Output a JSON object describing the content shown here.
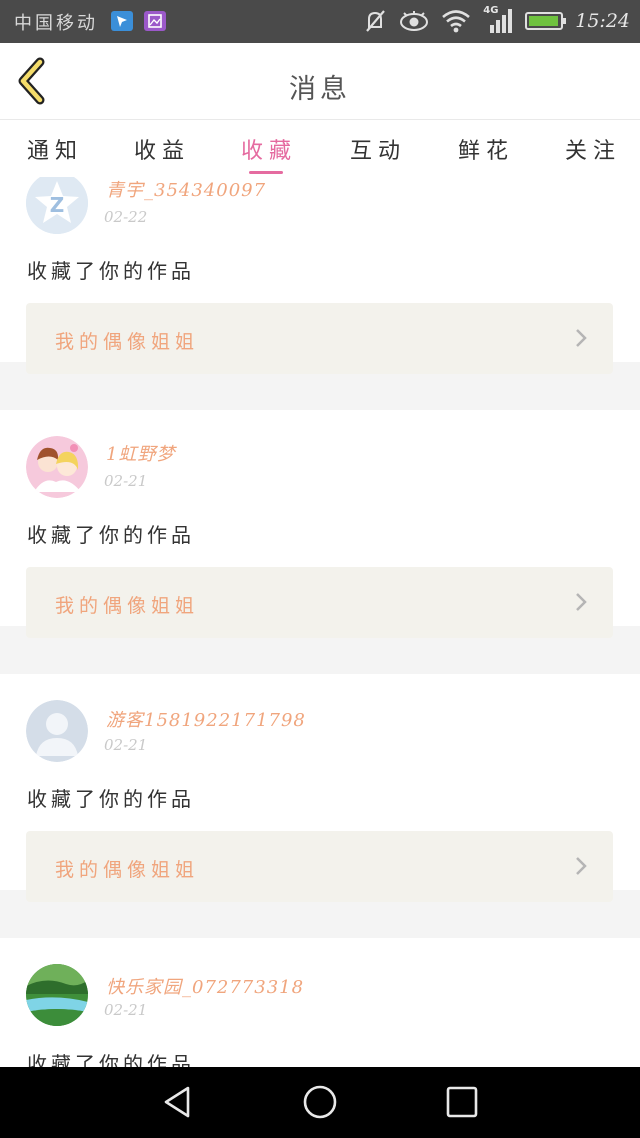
{
  "status_bar": {
    "carrier": "中国移动",
    "network": "4G",
    "time": "15:24",
    "battery_level": 0.95,
    "colors": {
      "background": "#4a4a4a",
      "battery": "#6fc23f"
    },
    "icons": [
      "app-notification-icon",
      "gallery-notification-icon",
      "mute-icon",
      "eye-icon",
      "wifi-icon",
      "signal-icon",
      "battery-icon"
    ]
  },
  "header": {
    "title": "消息",
    "back_icon": "chevron-left-icon"
  },
  "tabs": [
    {
      "label": "通知",
      "active": false
    },
    {
      "label": "收益",
      "active": false
    },
    {
      "label": "收藏",
      "active": true
    },
    {
      "label": "互动",
      "active": false
    },
    {
      "label": "鲜花",
      "active": false
    },
    {
      "label": "关注",
      "active": false
    }
  ],
  "feed": [
    {
      "username": "青宇_354340097",
      "date": "02-22",
      "action": "收藏了你的作品",
      "work_title": "我的偶像姐姐",
      "avatar": "qq-default-avatar"
    },
    {
      "username": "1虹野梦",
      "date": "02-21",
      "action": "收藏了你的作品",
      "work_title": "我的偶像姐姐",
      "avatar": "anime-couple-avatar"
    },
    {
      "username": "游客1581922171798",
      "date": "02-21",
      "action": "收藏了你的作品",
      "work_title": "我的偶像姐姐",
      "avatar": "default-person-avatar"
    },
    {
      "username": "快乐家园_072773318",
      "date": "02-21",
      "action": "收藏了你的作品",
      "work_title": "",
      "avatar": "landscape-avatar"
    }
  ],
  "colors": {
    "accent": "#e56ba0",
    "username": "#f0a57d",
    "work_box_bg": "#f3f2ec",
    "separator": "#f4f4f4"
  },
  "nav_bar": {
    "icons": [
      "back-triangle-icon",
      "home-circle-icon",
      "recents-square-icon"
    ]
  }
}
